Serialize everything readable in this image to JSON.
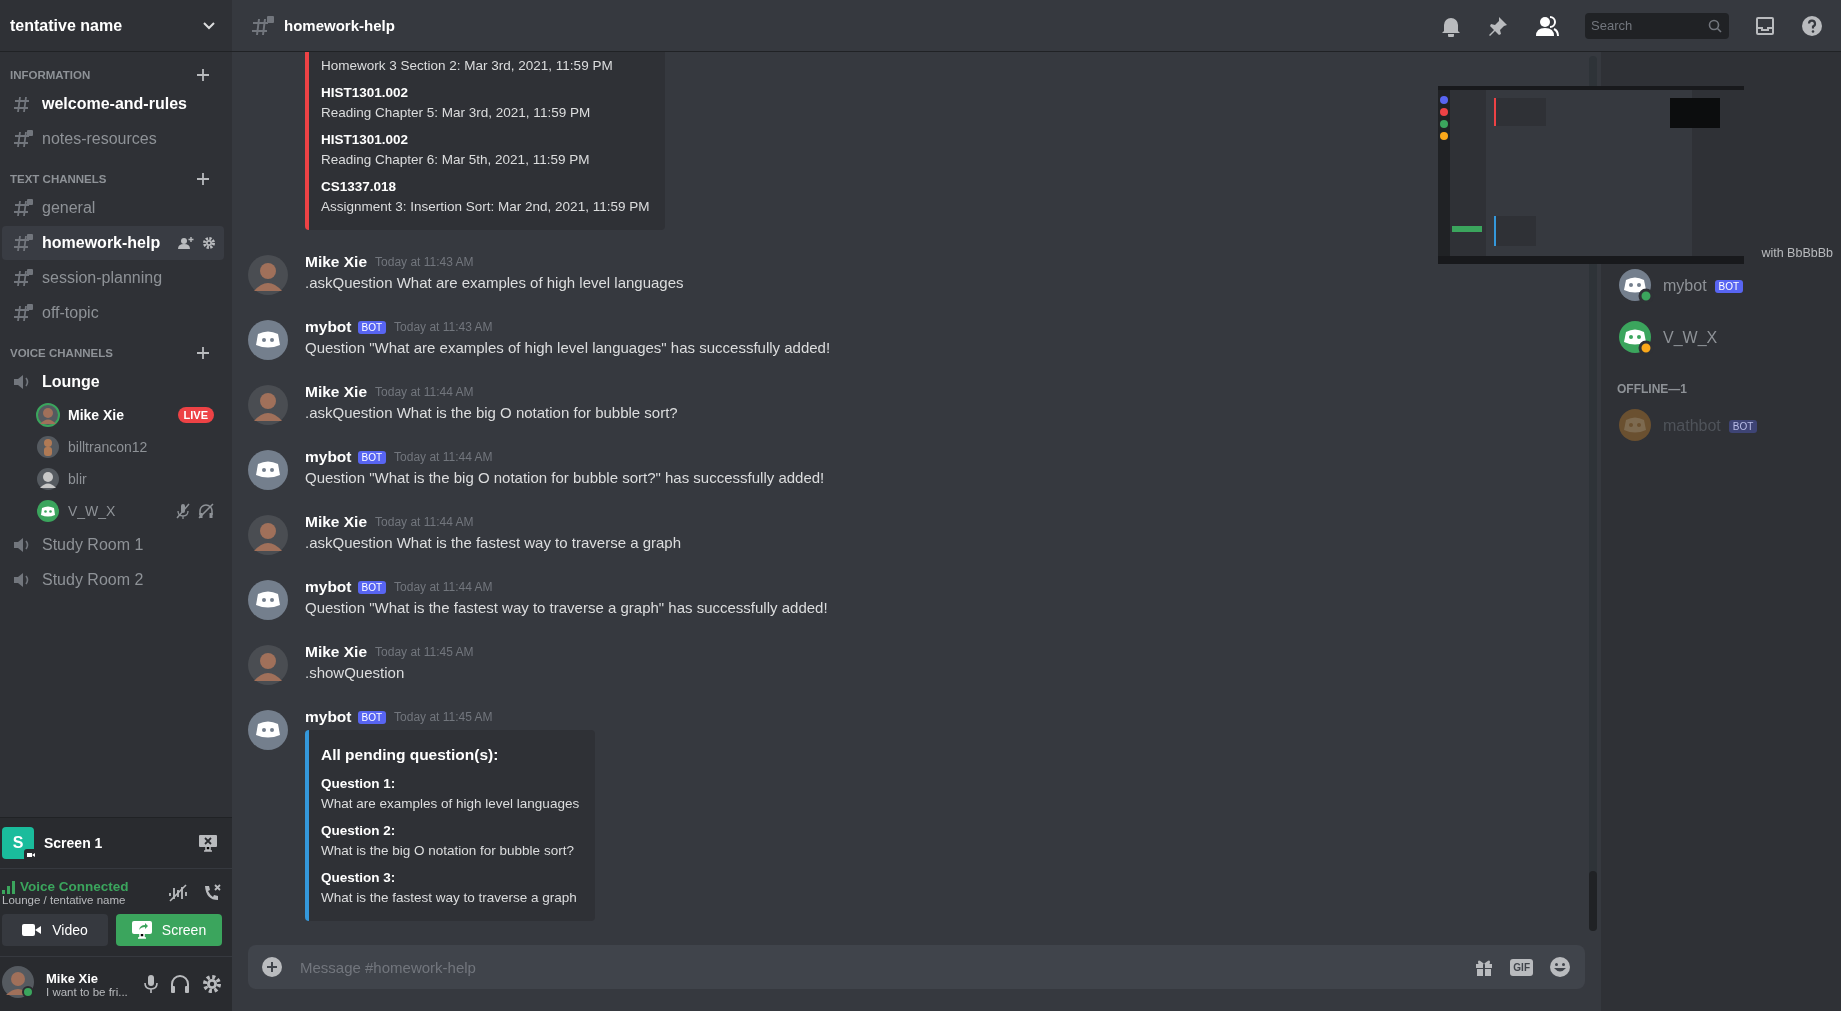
{
  "server": {
    "name": "tentative name"
  },
  "categories": [
    {
      "name": "INFORMATION",
      "channels": [
        {
          "kind": "text",
          "name": "welcome-and-rules",
          "locked": false,
          "unread": true,
          "selected": false
        },
        {
          "kind": "text",
          "name": "notes-resources",
          "locked": true,
          "unread": false,
          "selected": false
        }
      ]
    },
    {
      "name": "TEXT CHANNELS",
      "channels": [
        {
          "kind": "text",
          "name": "general",
          "locked": true,
          "unread": false,
          "selected": false
        },
        {
          "kind": "text",
          "name": "homework-help",
          "locked": true,
          "unread": false,
          "selected": true
        },
        {
          "kind": "text",
          "name": "session-planning",
          "locked": true,
          "unread": false,
          "selected": false
        },
        {
          "kind": "text",
          "name": "off-topic",
          "locked": true,
          "unread": false,
          "selected": false
        }
      ]
    },
    {
      "name": "VOICE CHANNELS",
      "channels": [
        {
          "kind": "voice",
          "name": "Lounge",
          "unread": true,
          "selected": false,
          "users": [
            {
              "name": "Mike Xie",
              "avatar": {
                "kind": "photo",
                "color": "#a0705a"
              },
              "speaking": true,
              "live": "LIVE",
              "muted": false,
              "deafened": false
            },
            {
              "name": "billtrancon12",
              "avatar": {
                "kind": "figure",
                "color": "#b07a55"
              },
              "speaking": false,
              "muted": false,
              "deafened": false
            },
            {
              "name": "blir",
              "avatar": {
                "kind": "photo",
                "color": "#c8c8c8"
              },
              "speaking": false,
              "muted": false,
              "deafened": false
            },
            {
              "name": "V_W_X",
              "avatar": {
                "kind": "logo",
                "color": "#3ba55d"
              },
              "speaking": false,
              "muted": true,
              "deafened": true
            }
          ]
        },
        {
          "kind": "voice",
          "name": "Study Room 1",
          "unread": false,
          "selected": false
        },
        {
          "kind": "voice",
          "name": "Study Room 2",
          "unread": false,
          "selected": false
        }
      ]
    }
  ],
  "stream": {
    "initial": "S",
    "name": "Screen 1"
  },
  "voice": {
    "status": "Voice Connected",
    "location": "Lounge / tentative name",
    "buttons": [
      {
        "kind": "video",
        "label": "Video",
        "active": false
      },
      {
        "kind": "screen",
        "label": "Screen",
        "active": true
      }
    ]
  },
  "user": {
    "name": "Mike Xie",
    "status": "I want to be fri..."
  },
  "header": {
    "channel": "homework-help",
    "search": {
      "placeholder": "Search"
    }
  },
  "messages": [
    {
      "kind": "embed-only",
      "embed": {
        "color": "#ed4245",
        "fields": [
          {
            "value": "Homework 3 Section 2: Mar 3rd, 2021, 11:59 PM"
          },
          {
            "title": "HIST1301.002",
            "value": "Reading Chapter 5: Mar 3rd, 2021, 11:59 PM"
          },
          {
            "title": "HIST1301.002",
            "value": "Reading Chapter 6: Mar 5th, 2021, 11:59 PM"
          },
          {
            "title": "CS1337.018",
            "value": "Assignment 3: Insertion Sort: Mar 2nd, 2021, 11:59 PM"
          }
        ]
      }
    },
    {
      "kind": "text",
      "author": "Mike Xie",
      "avatar": {
        "kind": "photo",
        "color": "#a0705a"
      },
      "time": "Today at 11:43 AM",
      "text": ".askQuestion What are examples of high level languages"
    },
    {
      "kind": "text",
      "author": "mybot",
      "badge": "BOT",
      "avatar": {
        "kind": "logo",
        "color": "#747f8d"
      },
      "time": "Today at 11:43 AM",
      "text": "Question \"What are examples of high level languages\" has successfully added!"
    },
    {
      "kind": "text",
      "author": "Mike Xie",
      "avatar": {
        "kind": "photo",
        "color": "#a0705a"
      },
      "time": "Today at 11:44 AM",
      "text": ".askQuestion What is the big O notation for bubble sort?"
    },
    {
      "kind": "text",
      "author": "mybot",
      "badge": "BOT",
      "avatar": {
        "kind": "logo",
        "color": "#747f8d"
      },
      "time": "Today at 11:44 AM",
      "text": "Question \"What is the big O notation for bubble sort?\" has successfully added!"
    },
    {
      "kind": "text",
      "author": "Mike Xie",
      "avatar": {
        "kind": "photo",
        "color": "#a0705a"
      },
      "time": "Today at 11:44 AM",
      "text": ".askQuestion What is the fastest way to traverse a graph"
    },
    {
      "kind": "text",
      "author": "mybot",
      "badge": "BOT",
      "avatar": {
        "kind": "logo",
        "color": "#747f8d"
      },
      "time": "Today at 11:44 AM",
      "text": "Question \"What is the fastest way to traverse a graph\" has successfully added!"
    },
    {
      "kind": "text",
      "author": "Mike Xie",
      "avatar": {
        "kind": "photo",
        "color": "#a0705a"
      },
      "time": "Today at 11:45 AM",
      "text": ".showQuestion"
    },
    {
      "kind": "embed",
      "author": "mybot",
      "badge": "BOT",
      "avatar": {
        "kind": "logo",
        "color": "#747f8d"
      },
      "time": "Today at 11:45 AM",
      "embed": {
        "color": "#3498db",
        "title": "All pending question(s):",
        "fields": [
          {
            "title": "Question 1:",
            "value": "What are examples of high level languages"
          },
          {
            "title": "Question 2:",
            "value": "What is the big O notation for bubble sort?"
          },
          {
            "title": "Question 3:",
            "value": "What is the fastest way to traverse a graph"
          }
        ]
      }
    }
  ],
  "composer": {
    "placeholder": "Message #homework-help",
    "gif": "GIF"
  },
  "members": {
    "activity": "with BbBbBb",
    "online": [
      {
        "kind": "online",
        "name": "mybot",
        "badge": "BOT",
        "color": "#747f8d"
      },
      {
        "kind": "idle",
        "name": "V_W_X",
        "color": "#3ba55d"
      }
    ],
    "offline_heading": "OFFLINE—1",
    "offline": [
      {
        "kind": "offline",
        "name": "mathbot",
        "badge": "BOT",
        "color": "#6a5030"
      }
    ]
  }
}
